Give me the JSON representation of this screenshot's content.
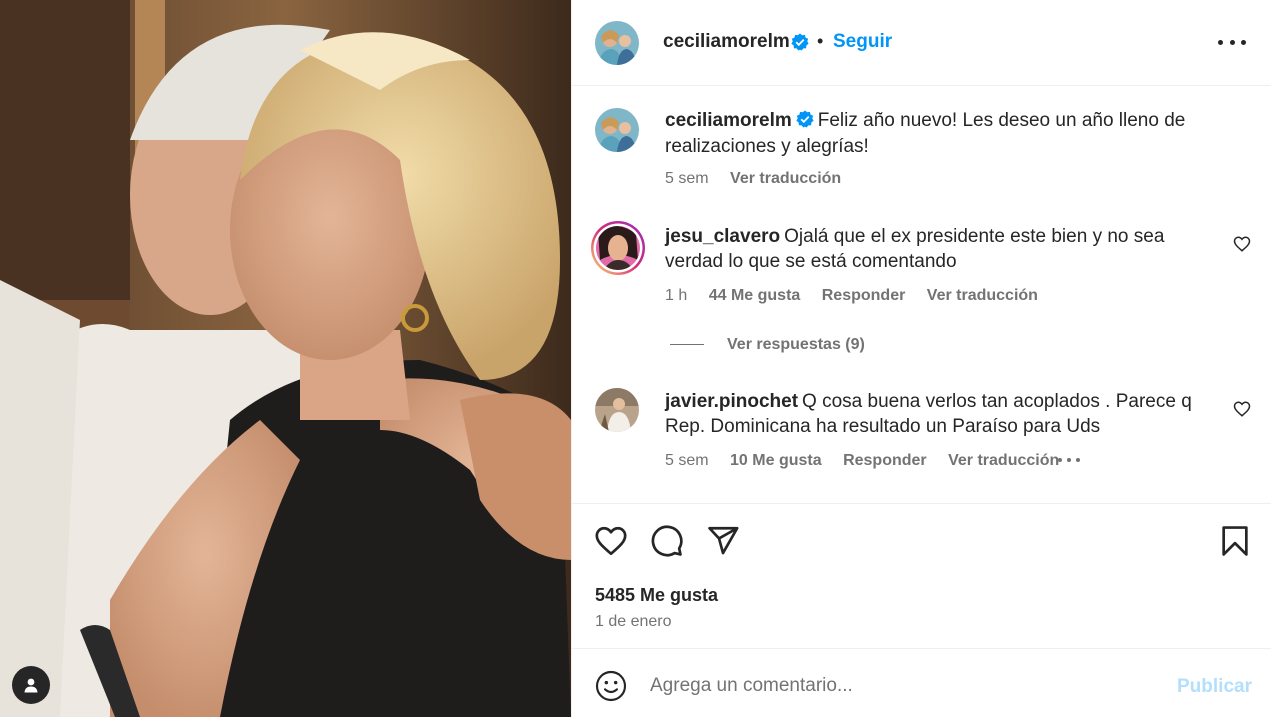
{
  "colors": {
    "accent": "#0095f6",
    "accent_disabled": "#b2dffc",
    "text_primary": "#262626",
    "text_secondary": "#737373",
    "verified_badge": "#0095f6"
  },
  "header": {
    "username": "ceciliamorelm",
    "separator": "•",
    "follow_label": "Seguir"
  },
  "caption": {
    "username": "ceciliamorelm",
    "text": "Feliz año nuevo! Les deseo un año lleno de realizaciones y alegrías!",
    "time": "5 sem",
    "translate_label": "Ver traducción"
  },
  "comments": [
    {
      "username": "jesu_clavero",
      "text": "Ojalá que el ex presidente este bien y no sea verdad lo que se está comentando",
      "time": "1 h",
      "likes": "44 Me gusta",
      "reply_label": "Responder",
      "translate_label": "Ver traducción",
      "view_replies_label": "Ver respuestas (9)"
    },
    {
      "username": "javier.pinochet",
      "text": "Q cosa buena verlos tan acoplados . Parece q Rep. Dominicana ha resultado un Paraíso para Uds",
      "time": "5 sem",
      "likes": "10 Me gusta",
      "reply_label": "Responder",
      "translate_label": "Ver traducción"
    }
  ],
  "actions": {
    "icons": [
      "heart-icon",
      "comment-icon",
      "share-icon",
      "bookmark-icon"
    ],
    "likes_count": "5485 Me gusta",
    "date": "1 de enero"
  },
  "comment_box": {
    "placeholder": "Agrega un comentario...",
    "publish_label": "Publicar"
  }
}
